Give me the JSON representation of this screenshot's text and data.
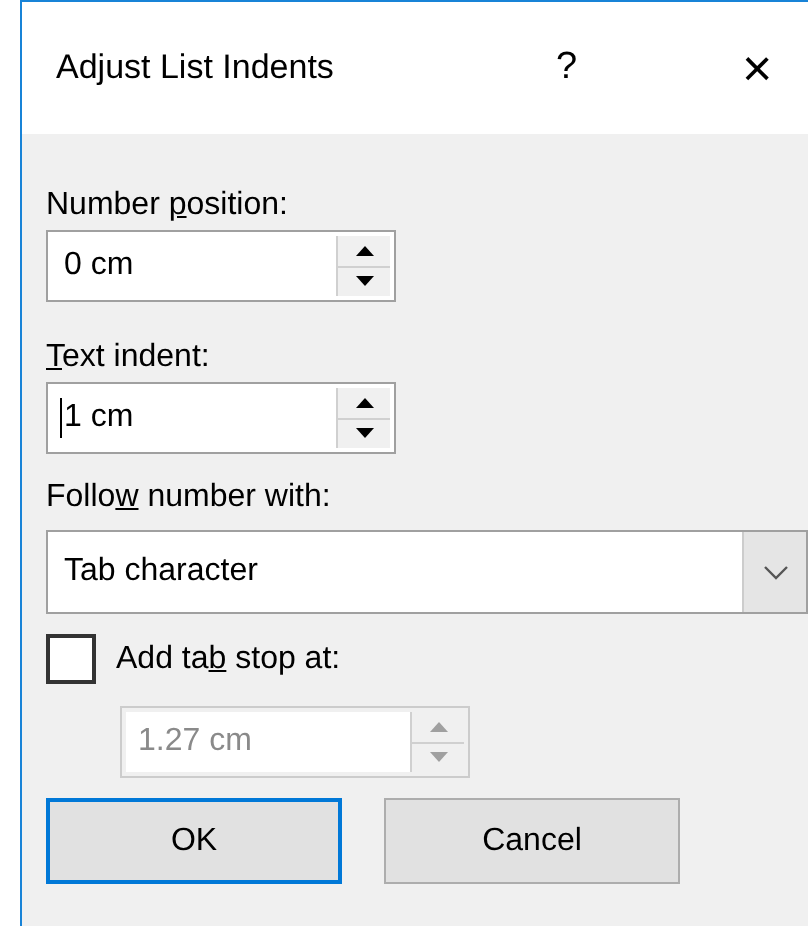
{
  "window": {
    "title": "Adjust List Indents",
    "help_glyph": "?",
    "close_glyph": "×"
  },
  "controls": [
    {
      "kind": "spin",
      "label": {
        "before": "Number ",
        "key": "p",
        "after": "osition:"
      },
      "value": "0 cm",
      "focused": false,
      "disabled": false
    },
    {
      "kind": "spin",
      "label": {
        "key": "T",
        "after": "ext indent:"
      },
      "value": "1 cm",
      "focused": true,
      "disabled": false
    },
    {
      "kind": "dropdown",
      "label": {
        "before": "Follo",
        "key": "w",
        "after": " number with:"
      },
      "value": "Tab character"
    },
    {
      "kind": "checkbox",
      "label": {
        "before": "Add ta",
        "key": "b",
        "after": " stop at:"
      },
      "checked": false
    },
    {
      "kind": "spin",
      "value": "1.27 cm",
      "focused": false,
      "disabled": true
    }
  ],
  "buttons": [
    {
      "label": "OK",
      "default": true
    },
    {
      "label": "Cancel",
      "default": false
    }
  ]
}
